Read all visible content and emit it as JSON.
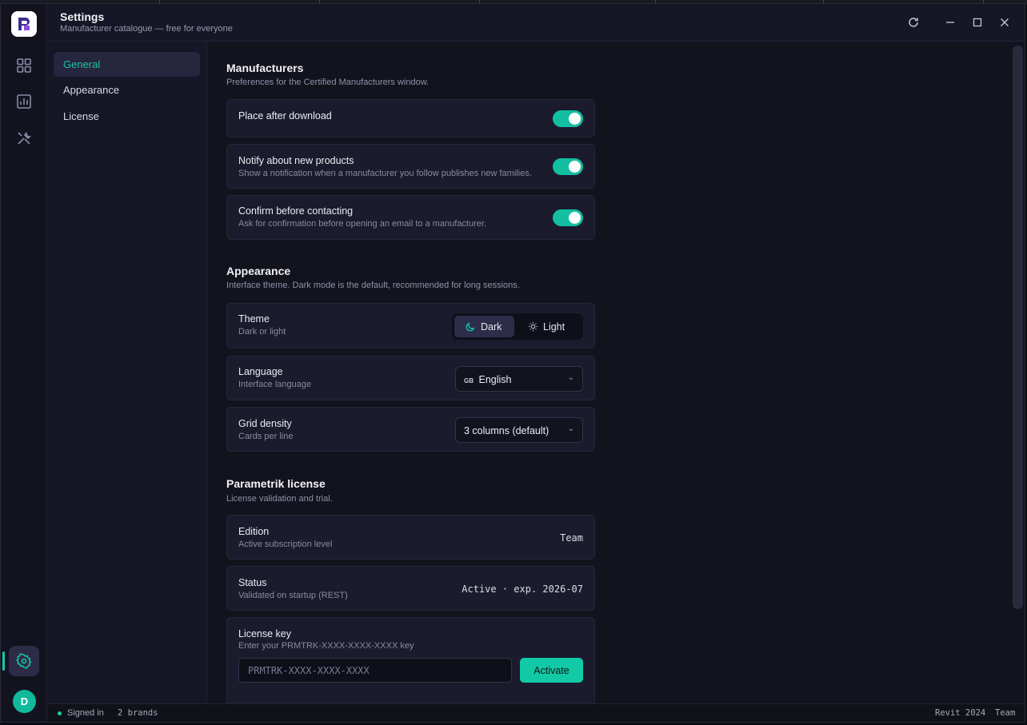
{
  "app": {
    "title": "Settings",
    "subtitle": "Manufacturer catalogue — free for everyone",
    "accent": "#17c8a8",
    "avatar_initial": "D"
  },
  "nav": {
    "items": [
      {
        "label": "General",
        "active": true
      },
      {
        "label": "Appearance",
        "active": false
      },
      {
        "label": "License",
        "active": false
      }
    ]
  },
  "manufacturers": {
    "title": "Manufacturers",
    "subtitle": "Preferences for the Certified Manufacturers window.",
    "settings": [
      {
        "label": "Place after download",
        "desc": "",
        "on": true
      },
      {
        "label": "Notify about new products",
        "desc": "Show a notification when a manufacturer you follow publishes new families.",
        "on": true
      },
      {
        "label": "Confirm before contacting",
        "desc": "Ask for confirmation before opening an email to a manufacturer.",
        "on": true
      }
    ]
  },
  "appearance": {
    "title": "Appearance",
    "subtitle": "Interface theme. Dark mode is the default, recommended for long sessions.",
    "theme": {
      "label": "Theme",
      "desc": "Dark or light",
      "options": [
        "Dark",
        "Light"
      ],
      "selected": "Dark"
    },
    "language": {
      "label": "Language",
      "desc": "Interface language",
      "flag": "GB",
      "value": "English"
    },
    "grid": {
      "label": "Grid density",
      "desc": "Cards per line",
      "value": "3 columns (default)"
    }
  },
  "license": {
    "title": "Parametrik license",
    "subtitle": "License validation and trial.",
    "edition": {
      "label": "Edition",
      "desc": "Active subscription level",
      "value": "Team"
    },
    "status": {
      "label": "Status",
      "desc": "Validated on startup (REST)",
      "value": "Active · exp. 2026-07"
    },
    "key": {
      "label": "License key",
      "desc": "Enter your PRMTRK-XXXX-XXXX-XXXX key",
      "placeholder": "PRMTRK-XXXX-XXXX-XXXX",
      "button": "Activate"
    }
  },
  "statusbar": {
    "signed_in": "Signed in",
    "brands": "2 brands",
    "host": "Revit 2024",
    "edition": "Team"
  },
  "icons": [
    "logo-icon",
    "grid-icon",
    "chart-icon",
    "tools-icon",
    "gear-icon",
    "refresh-icon",
    "minimize-icon",
    "maximize-icon",
    "close-icon",
    "moon-icon",
    "sun-icon",
    "chevron-down-icon"
  ]
}
